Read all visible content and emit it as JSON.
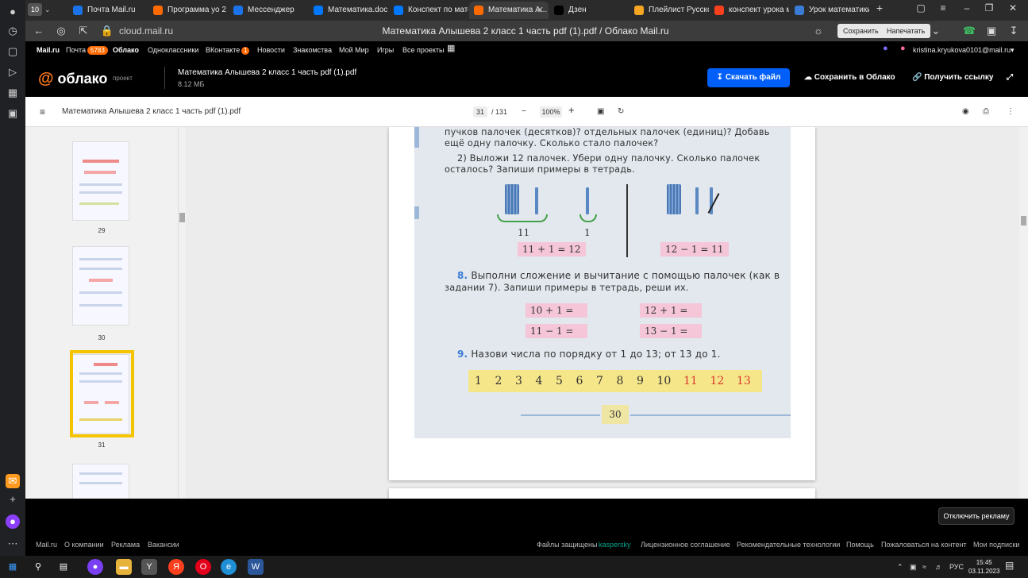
{
  "browser": {
    "tab_count": "10",
    "tabs": [
      {
        "label": "Почта Mail.ru",
        "icon": "mail-icon",
        "color": "#1a73e8"
      },
      {
        "label": "Программа уо 2 ...",
        "icon": "cloud-icon",
        "color": "#ff6a00"
      },
      {
        "label": "Мессенджер",
        "icon": "messenger-icon",
        "color": "#1a73e8"
      },
      {
        "label": "Математика.doc...",
        "icon": "vk-icon",
        "color": "#0077ff"
      },
      {
        "label": "Конспект по мате...",
        "icon": "vk-icon",
        "color": "#0077ff"
      },
      {
        "label": "Математика А...",
        "icon": "cloud-icon",
        "color": "#ff6a00"
      },
      {
        "label": "Дзен",
        "icon": "dzen-icon",
        "color": "#000000"
      },
      {
        "label": "Плейлист Русско...",
        "icon": "playlist-icon",
        "color": "#f5a623"
      },
      {
        "label": "конспект урока м...",
        "icon": "yandex-icon",
        "color": "#fc3f1d"
      },
      {
        "label": "Урок математики...",
        "icon": "doc-icon",
        "color": "#3a7bd5"
      }
    ],
    "url": "cloud.mail.ru",
    "page_title": "Математика Алышева 2 класс 1 часть pdf (1).pdf / Облако Mail.ru",
    "save_button": "Сохранить",
    "print_button": "Напечатать"
  },
  "portal": {
    "links": [
      "Mail.ru",
      "Почта",
      "Облако",
      "Одноклассники",
      "ВКонтакте",
      "Новости",
      "Знакомства",
      "Мой Мир",
      "Игры",
      "Все проекты"
    ],
    "mail_badge": "5783",
    "vk_badge": "1",
    "user_email": "kristina.kryukova0101@mail.ru"
  },
  "cloud": {
    "logo": "облако",
    "project_label": "проект",
    "file_name": "Математика Алышева 2 класс 1 часть pdf (1).pdf",
    "file_size": "8.12 МБ",
    "download_button": "Скачать файл",
    "save_to_cloud": "Сохранить в Облако",
    "get_link": "Получить ссылку"
  },
  "viewer": {
    "file_name": "Математика Алышева 2 класс 1 часть pdf (1).pdf",
    "current_page": "31",
    "total_pages": "/ 131",
    "zoom": "100%",
    "thumbnails": [
      {
        "label": "29"
      },
      {
        "label": "30"
      },
      {
        "label": "31"
      }
    ]
  },
  "page_content": {
    "line1": "пучков палочек (десятков)? отдельных палочек (единиц)? Добавь",
    "line2": "ещё одну палочку. Сколько стало палочек?",
    "line3": "2) Выложи 12 палочек. Убери одну палочку. Сколько палочек",
    "line4": "осталось? Запиши примеры в тетрадь.",
    "label_11": "11",
    "label_1": "1",
    "eq_add": "11 + 1 = 12",
    "eq_sub": "12 − 1 = 11",
    "task8_num": "8.",
    "task8_line1": "Выполни сложение и вычитание с помощью палочек (как в",
    "task8_line2": "задании 7). Запиши примеры в тетрадь, реши их.",
    "ex1": "10 + 1 =",
    "ex2": "12 + 1 =",
    "ex3": "11 − 1 =",
    "ex4": "13 − 1 =",
    "task9_num": "9.",
    "task9_text": "Назови числа по порядку от 1 до 13; от 13 до 1.",
    "numbers": [
      "1",
      "2",
      "3",
      "4",
      "5",
      "6",
      "7",
      "8",
      "9",
      "10",
      "11",
      "12",
      "13"
    ],
    "page_number": "30"
  },
  "footer": {
    "noads_button": "Отключить рекламу",
    "left_links": [
      "Mail.ru",
      "О компании",
      "Реклама",
      "Вакансии"
    ],
    "protected_text": "Файлы защищены",
    "kaspersky": "kaspersky",
    "right_links": [
      "Лицензионное соглашение",
      "Рекомендательные технологии",
      "Помощь",
      "Пожаловаться на контент",
      "Мои подписки"
    ]
  },
  "taskbar": {
    "lang": "РУС",
    "time": "15:45",
    "date": "03.11.2023"
  }
}
